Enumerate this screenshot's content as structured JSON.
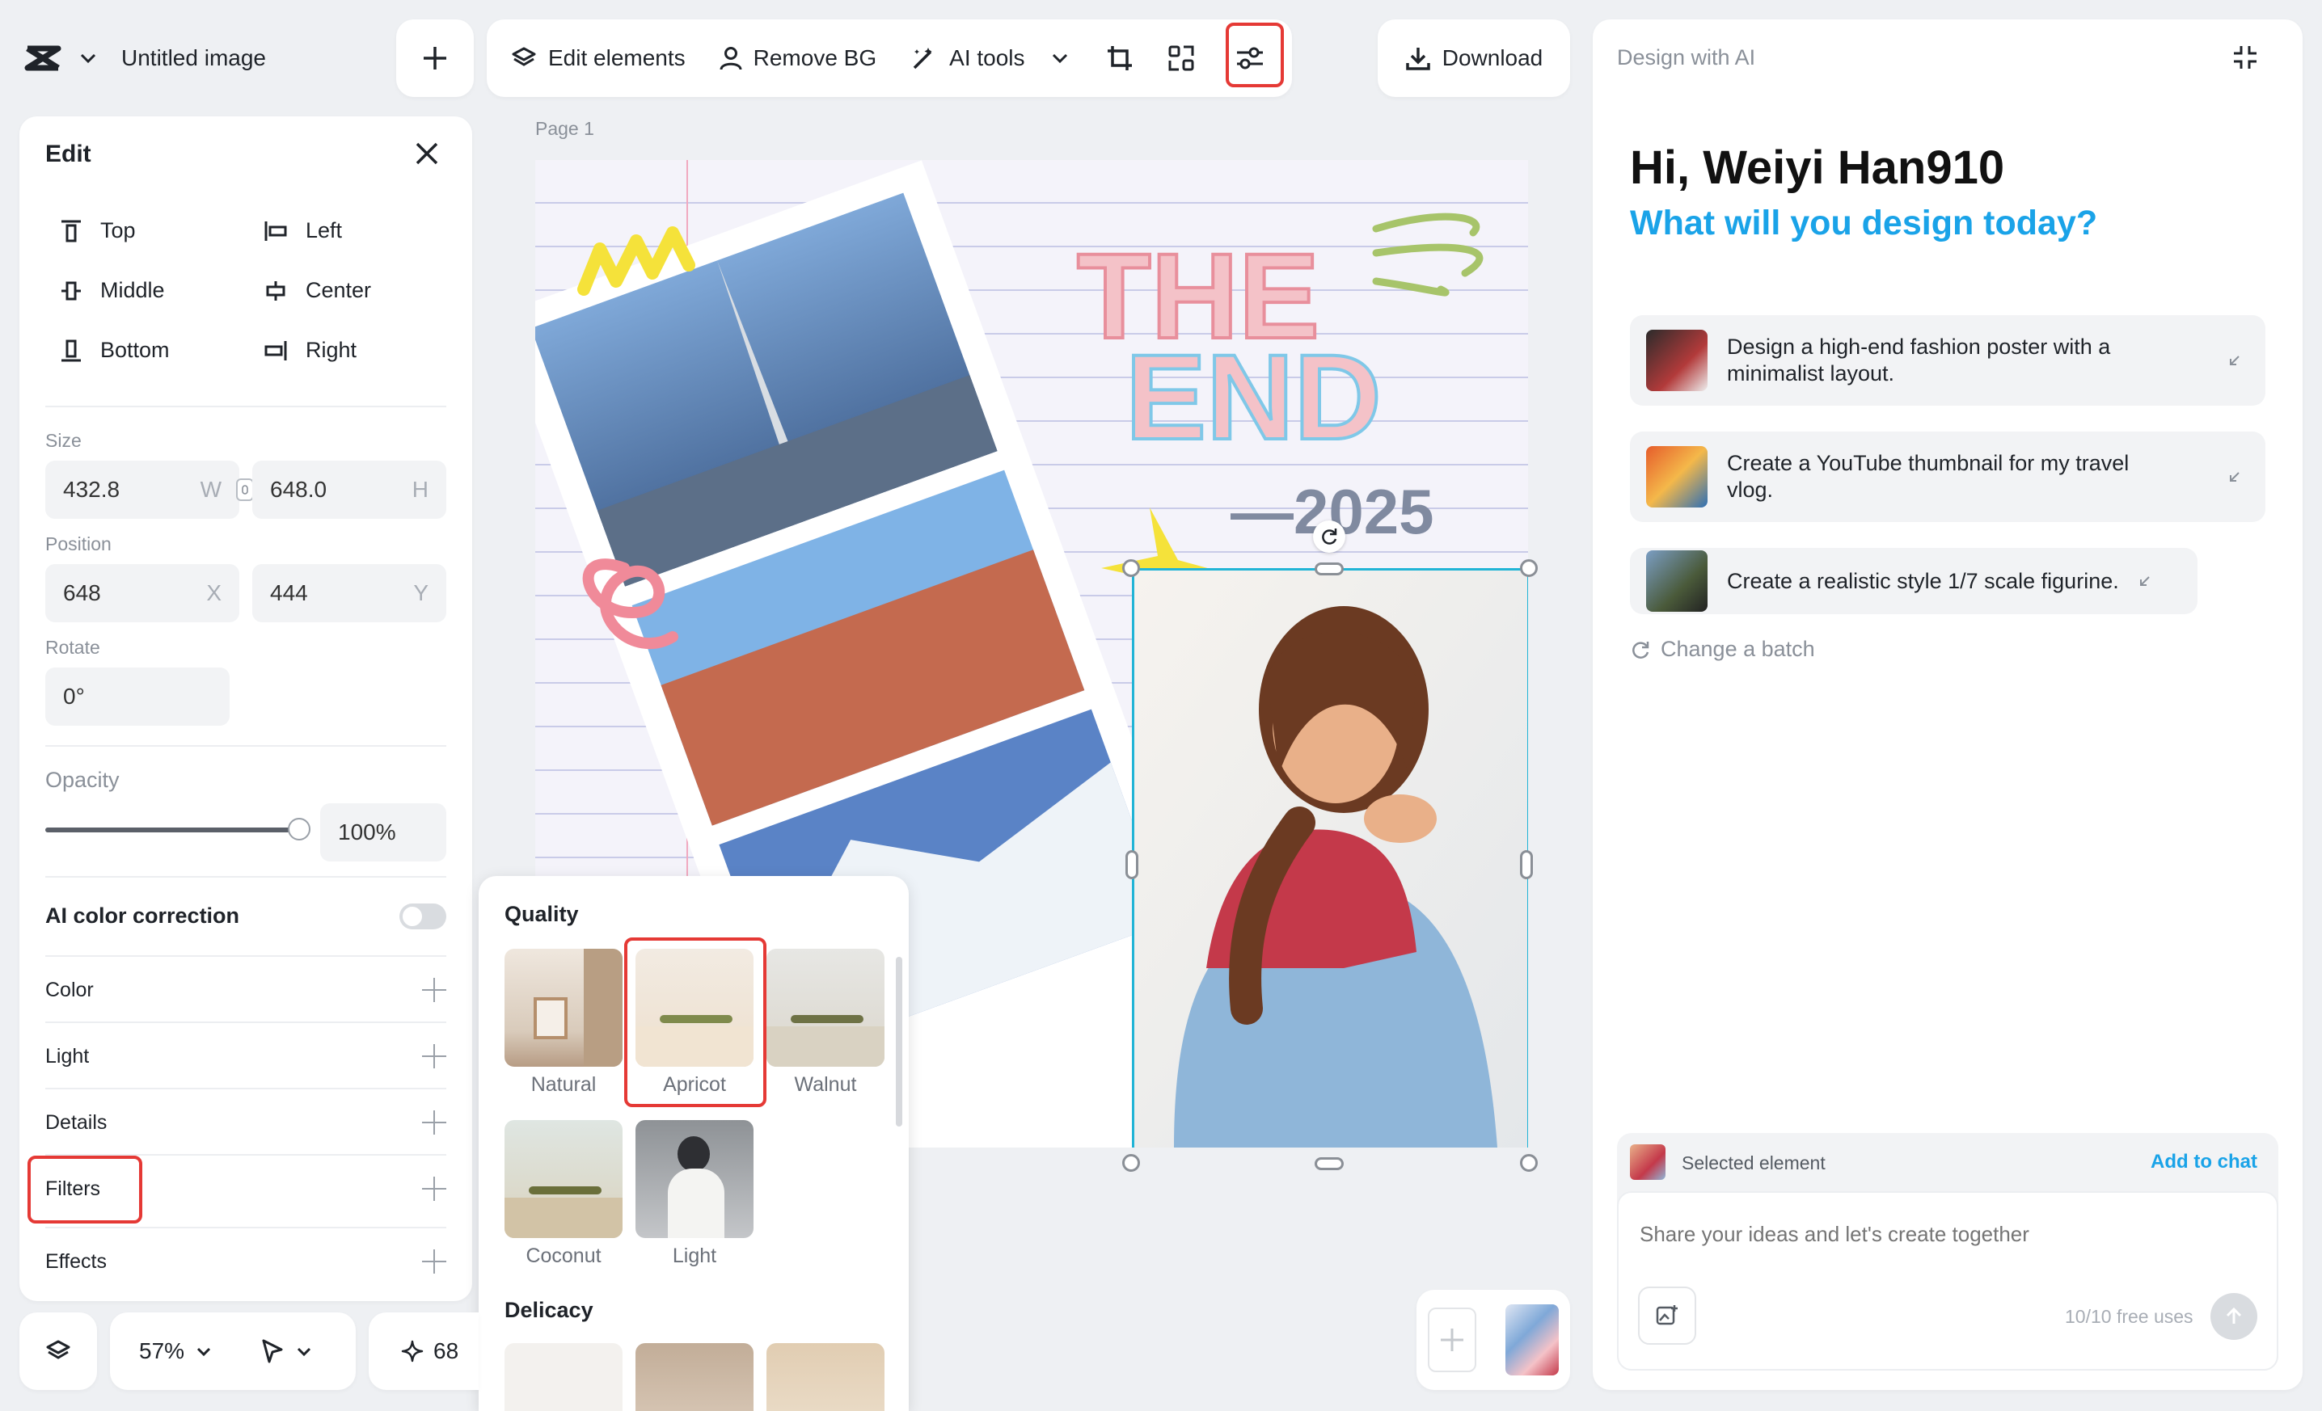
{
  "app": {
    "doc_title": "Untitled image"
  },
  "toolbar": {
    "edit_elements": "Edit elements",
    "remove_bg": "Remove BG",
    "ai_tools": "AI tools",
    "download": "Download"
  },
  "canvas": {
    "page_label": "Page 1",
    "artwork_text": "THE END",
    "artwork_year": "—2025"
  },
  "edit_panel": {
    "title": "Edit",
    "align": {
      "top": "Top",
      "middle": "Middle",
      "bottom": "Bottom",
      "left": "Left",
      "center": "Center",
      "right": "Right"
    },
    "size": {
      "label": "Size",
      "w": "432.8",
      "w_unit": "W",
      "h": "648.0",
      "h_unit": "H"
    },
    "position": {
      "label": "Position",
      "x": "648",
      "x_unit": "X",
      "y": "444",
      "y_unit": "Y"
    },
    "rotate": {
      "label": "Rotate",
      "value": "0°"
    },
    "opacity": {
      "label": "Opacity",
      "value": "100%",
      "level": 1.0
    },
    "ai_color_correction": {
      "label": "AI color correction",
      "enabled": false
    },
    "sections": [
      "Color",
      "Light",
      "Details",
      "Filters",
      "Effects"
    ]
  },
  "filters_popup": {
    "quality_heading": "Quality",
    "quality": [
      "Natural",
      "Apricot",
      "Walnut",
      "Coconut",
      "Light"
    ],
    "selected": "Apricot",
    "delicacy_heading": "Delicacy"
  },
  "bottom_bar": {
    "zoom": "57%",
    "credits": "68"
  },
  "ai_panel": {
    "header": "Design with AI",
    "greeting": "Hi, Weiyi Han910",
    "subtitle": "What will you design today?",
    "suggestions": [
      "Design a high-end fashion poster with a minimalist layout.",
      "Create a YouTube thumbnail for my travel vlog.",
      "Create a realistic style 1/7 scale figurine."
    ],
    "change_batch": "Change a batch",
    "selected_element": "Selected element",
    "add_to_chat": "Add to chat",
    "input_placeholder": "Share your ideas and let's create together",
    "free_uses": "10/10 free uses"
  },
  "colors": {
    "accent": "#1aa3e8",
    "selection": "#21b4d6",
    "highlight": "#e53935"
  }
}
